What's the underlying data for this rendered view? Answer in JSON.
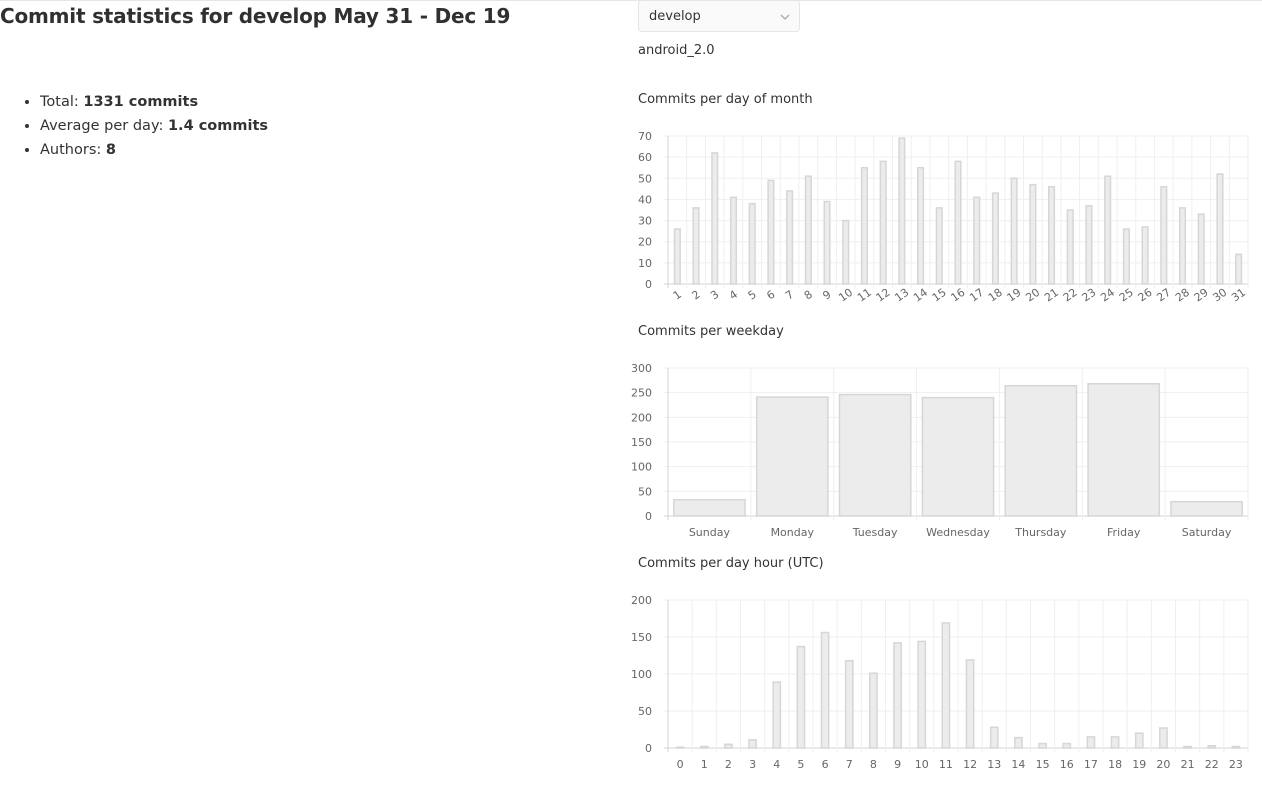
{
  "page": {
    "title": "Commit statistics for develop May 31 - Dec 19"
  },
  "stats": {
    "total_label": "Total:",
    "total_value": "1331 commits",
    "average_label": "Average per day:",
    "average_value": "1.4 commits",
    "authors_label": "Authors:",
    "authors_value": "8"
  },
  "branch_select": {
    "selected": "develop",
    "icon": "chevron-down-icon"
  },
  "tag_label": "android_2.0",
  "colors": {
    "bar_fill": "#ececec",
    "bar_stroke": "#d6d6d6",
    "grid": "#efefef",
    "text": "#666666"
  },
  "chart_data": [
    {
      "type": "bar",
      "title": "Commits per day of month",
      "categories": [
        "1",
        "2",
        "3",
        "4",
        "5",
        "6",
        "7",
        "8",
        "9",
        "10",
        "11",
        "12",
        "13",
        "14",
        "15",
        "16",
        "17",
        "18",
        "19",
        "20",
        "21",
        "22",
        "23",
        "24",
        "25",
        "26",
        "27",
        "28",
        "29",
        "30",
        "31"
      ],
      "values": [
        26,
        36,
        62,
        41,
        38,
        49,
        44,
        51,
        39,
        30,
        55,
        58,
        69,
        55,
        36,
        58,
        41,
        43,
        50,
        47,
        46,
        35,
        37,
        51,
        26,
        27,
        46,
        36,
        33,
        52,
        14
      ],
      "ylim": [
        0,
        70
      ],
      "yticks": [
        0,
        10,
        20,
        30,
        40,
        50,
        60,
        70
      ],
      "rotate_labels": true,
      "grid": true
    },
    {
      "type": "bar",
      "title": "Commits per weekday",
      "categories": [
        "Sunday",
        "Monday",
        "Tuesday",
        "Wednesday",
        "Thursday",
        "Friday",
        "Saturday"
      ],
      "values": [
        33,
        241,
        246,
        240,
        264,
        268,
        29
      ],
      "ylim": [
        0,
        300
      ],
      "yticks": [
        0,
        50,
        100,
        150,
        200,
        250,
        300
      ],
      "rotate_labels": false,
      "grid": true
    },
    {
      "type": "bar",
      "title": "Commits per day hour (UTC)",
      "categories": [
        "0",
        "1",
        "2",
        "3",
        "4",
        "5",
        "6",
        "7",
        "8",
        "9",
        "10",
        "11",
        "12",
        "13",
        "14",
        "15",
        "16",
        "17",
        "18",
        "19",
        "20",
        "21",
        "22",
        "23"
      ],
      "values": [
        1,
        2,
        5,
        11,
        89,
        137,
        156,
        118,
        101,
        142,
        144,
        169,
        119,
        28,
        14,
        6,
        6,
        15,
        15,
        20,
        27,
        2,
        3,
        2
      ],
      "ylim": [
        0,
        200
      ],
      "yticks": [
        0,
        50,
        100,
        150,
        200
      ],
      "rotate_labels": false,
      "grid": true
    }
  ]
}
